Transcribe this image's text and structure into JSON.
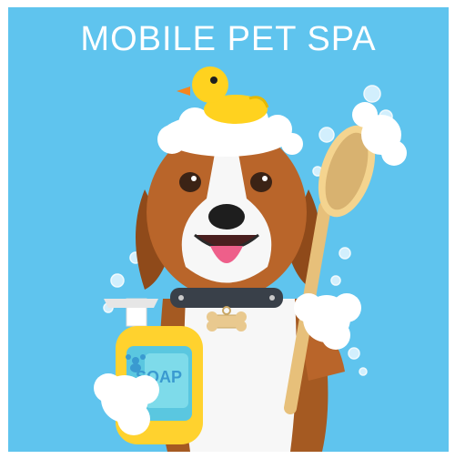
{
  "poster": {
    "title": "MOBILE PET SPA",
    "soap_label": "SOAP"
  },
  "colors": {
    "background": "#5fc4ee",
    "title_text": "#ffffff",
    "duck": "#ffd21f",
    "soap_bottle": "#ffd22e",
    "brush": "#e7c07a",
    "collar": "#394049",
    "tag": "#e9c98f"
  },
  "icons": [
    "rubber-duck-icon",
    "beagle-icon",
    "soap-bottle-icon",
    "bath-brush-icon",
    "bubbles-icon",
    "paw-icon"
  ]
}
